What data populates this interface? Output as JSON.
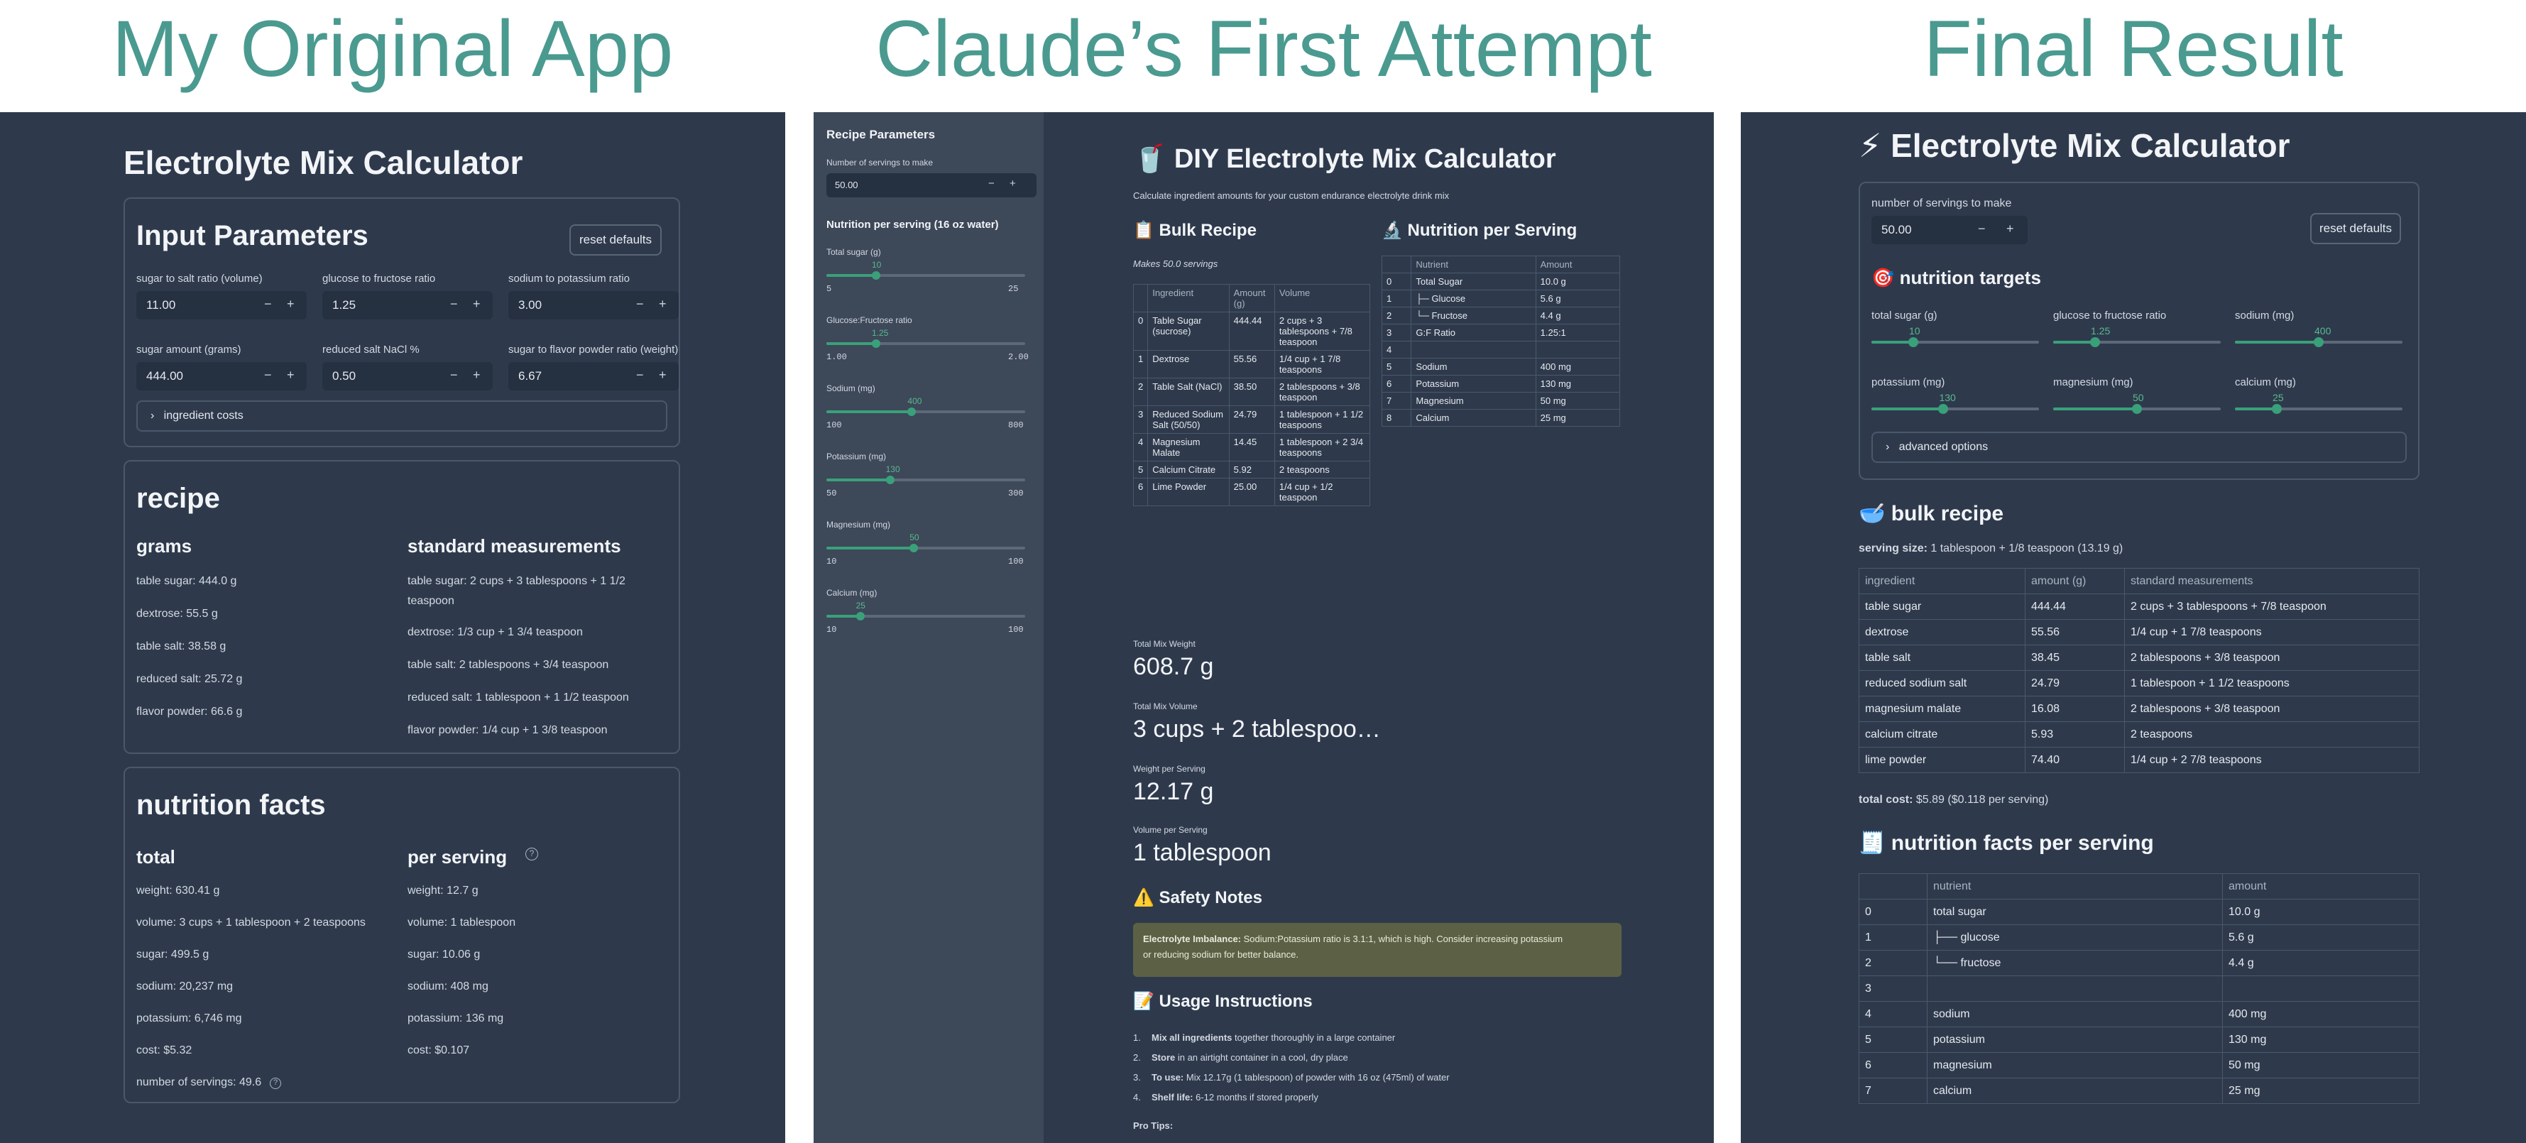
{
  "headings": {
    "original": "My Original App",
    "first": "Claude’s First Attempt",
    "final": "Final Result"
  },
  "original": {
    "title": "Electrolyte Mix Calculator",
    "input_title": "Input Parameters",
    "reset": "reset defaults",
    "fields": [
      {
        "label": "sugar to salt ratio (volume)",
        "value": "11.00"
      },
      {
        "label": "glucose to fructose ratio",
        "value": "1.25"
      },
      {
        "label": "sodium to potassium ratio",
        "value": "3.00"
      },
      {
        "label": "sugar amount (grams)",
        "value": "444.00"
      },
      {
        "label": "reduced salt NaCl %",
        "value": "0.50"
      },
      {
        "label": "sugar to flavor powder ratio (weight)",
        "value": "6.67"
      }
    ],
    "costs_expander": "ingredient costs",
    "recipe_title": "recipe",
    "grams_title": "grams",
    "grams": [
      "table sugar: 444.0 g",
      "dextrose: 55.5 g",
      "table salt: 38.58 g",
      "reduced salt: 25.72 g",
      "flavor powder: 66.6 g"
    ],
    "std_title": "standard measurements",
    "std_lines": [
      "table sugar: 2 cups + 3 tablespoons + 1 1/2",
      "teaspoon",
      "dextrose: 1/3 cup + 1 3/4 teaspoon",
      "table salt: 2 tablespoons + 3/4 teaspoon",
      "reduced salt: 1 tablespoon + 1 1/2 teaspoon",
      "flavor powder: 1/4 cup + 1 3/8 teaspoon"
    ],
    "nf_title": "nutrition facts",
    "total_title": "total",
    "total": [
      "weight: 630.41 g",
      "volume: 3 cups + 1 tablespoon + 2 teaspoons",
      "sugar: 499.5 g",
      "sodium: 20,237 mg",
      "potassium: 6,746 mg",
      "cost: $5.32"
    ],
    "per_title": "per serving",
    "per": [
      "weight: 12.7 g",
      "volume: 1 tablespoon",
      "sugar: 10.06 g",
      "sodium: 408 mg",
      "potassium: 136 mg",
      "cost: $0.107"
    ],
    "servings": "number of servings: 49.6"
  },
  "first": {
    "sidebar": {
      "title": "Recipe Parameters",
      "servings_label": "Number of servings to make",
      "servings_value": "50.00",
      "nutrition_title": "Nutrition per serving (16 oz water)",
      "sliders": [
        {
          "label": "Total sugar (g)",
          "value": "10",
          "min": "5",
          "max": "25",
          "frac": 0.25
        },
        {
          "label": "Glucose:Fructose ratio",
          "value": "1.25",
          "min": "1.00",
          "max": "2.00",
          "frac": 0.25
        },
        {
          "label": "Sodium (mg)",
          "value": "400",
          "min": "100",
          "max": "800",
          "frac": 0.43
        },
        {
          "label": "Potassium (mg)",
          "value": "130",
          "min": "50",
          "max": "300",
          "frac": 0.32
        },
        {
          "label": "Magnesium (mg)",
          "value": "50",
          "min": "10",
          "max": "100",
          "frac": 0.44
        },
        {
          "label": "Calcium (mg)",
          "value": "25",
          "min": "10",
          "max": "100",
          "frac": 0.17
        }
      ]
    },
    "title": "🥤 DIY Electrolyte Mix Calculator",
    "subtitle": "Calculate ingredient amounts for your custom endurance electrolyte drink mix",
    "bulk_title": "📋 Bulk Recipe",
    "makes": "Makes 50.0 servings",
    "bulk_headers": [
      "",
      "Ingredient",
      "Amount (g)",
      "Volume"
    ],
    "bulk_rows": [
      [
        "0",
        "Table Sugar (sucrose)",
        "444.44",
        "2 cups + 3 tablespoons + 7/8 teaspoon"
      ],
      [
        "1",
        "Dextrose",
        "55.56",
        "1/4 cup + 1 7/8 teaspoons"
      ],
      [
        "2",
        "Table Salt (NaCl)",
        "38.50",
        "2 tablespoons + 3/8 teaspoon"
      ],
      [
        "3",
        "Reduced Sodium Salt (50/50)",
        "24.79",
        "1 tablespoon + 1 1/2 teaspoons"
      ],
      [
        "4",
        "Magnesium Malate",
        "14.45",
        "1 tablespoon + 2 3/4 teaspoons"
      ],
      [
        "5",
        "Calcium Citrate",
        "5.92",
        "2 teaspoons"
      ],
      [
        "6",
        "Lime Powder",
        "25.00",
        "1/4 cup + 1/2 teaspoon"
      ]
    ],
    "nps_title": "🔬 Nutrition per Serving",
    "nps_headers": [
      "",
      "Nutrient",
      "Amount"
    ],
    "nps_rows": [
      [
        "0",
        "Total Sugar",
        "10.0 g"
      ],
      [
        "1",
        "├─ Glucose",
        "5.6 g"
      ],
      [
        "2",
        "└─ Fructose",
        "4.4 g"
      ],
      [
        "3",
        "G:F Ratio",
        "1.25:1"
      ],
      [
        "4",
        "",
        ""
      ],
      [
        "5",
        "Sodium",
        "400 mg"
      ],
      [
        "6",
        "Potassium",
        "130 mg"
      ],
      [
        "7",
        "Magnesium",
        "50 mg"
      ],
      [
        "8",
        "Calcium",
        "25 mg"
      ]
    ],
    "metrics": [
      {
        "label": "Total Mix Weight",
        "value": "608.7 g"
      },
      {
        "label": "Total Mix Volume",
        "value": "3 cups + 2 tablespoo…"
      },
      {
        "label": "Weight per Serving",
        "value": "12.17 g"
      },
      {
        "label": "Volume per Serving",
        "value": "1 tablespoon"
      }
    ],
    "safety_title": "⚠️ Safety Notes",
    "warn_bold": "Electrolyte Imbalance:",
    "warn_text1": " Sodium:Potassium ratio is 3.1:1, which is high. Consider increasing potassium",
    "warn_text2": "or reducing sodium for better balance.",
    "usage_title": "📝 Usage Instructions",
    "usage": [
      {
        "n": "1.",
        "b": "Mix all ingredients",
        "t": " together thoroughly in a large container"
      },
      {
        "n": "2.",
        "b": "Store",
        "t": " in an airtight container in a cool, dry place"
      },
      {
        "n": "3.",
        "b": "To use:",
        "t": " Mix 12.17g (1 tablespoon) of powder with 16 oz (475ml) of water"
      },
      {
        "n": "4.",
        "b": "Shelf life:",
        "t": " 6-12 months if stored properly"
      }
    ],
    "protips": "Pro Tips:"
  },
  "final": {
    "title": "⚡ Electrolyte Mix Calculator",
    "servings_label": "number of servings to make",
    "servings_value": "50.00",
    "reset": "reset defaults",
    "targets_title": "🎯 nutrition targets",
    "sliders": [
      {
        "label": "total sugar (g)",
        "value": "10",
        "frac": 0.25
      },
      {
        "label": "glucose to fructose ratio",
        "value": "1.25",
        "frac": 0.25
      },
      {
        "label": "sodium (mg)",
        "value": "400",
        "frac": 0.5
      },
      {
        "label": "potassium (mg)",
        "value": "130",
        "frac": 0.43
      },
      {
        "label": "magnesium (mg)",
        "value": "50",
        "frac": 0.5
      },
      {
        "label": "calcium (mg)",
        "value": "25",
        "frac": 0.25
      }
    ],
    "advanced": "advanced options",
    "bulk_title": "🥣 bulk recipe",
    "serving_bold": "serving size:",
    "serving_text": " 1 tablespoon + 1/8 teaspoon (13.19 g)",
    "bulk_headers": [
      "ingredient",
      "amount (g)",
      "standard measurements"
    ],
    "bulk_rows": [
      [
        "table sugar",
        "444.44",
        "2 cups + 3 tablespoons + 7/8 teaspoon"
      ],
      [
        "dextrose",
        "55.56",
        "1/4 cup + 1 7/8 teaspoons"
      ],
      [
        "table salt",
        "38.45",
        "2 tablespoons + 3/8 teaspoon"
      ],
      [
        "reduced sodium salt",
        "24.79",
        "1 tablespoon + 1 1/2 teaspoons"
      ],
      [
        "magnesium malate",
        "16.08",
        "2 tablespoons + 3/8 teaspoon"
      ],
      [
        "calcium citrate",
        "5.93",
        "2 teaspoons"
      ],
      [
        "lime powder",
        "74.40",
        "1/4 cup + 2 7/8 teaspoons"
      ]
    ],
    "cost_bold": "total cost:",
    "cost_text": " $5.89 ($0.118 per serving)",
    "nf_title": "🧾 nutrition facts per serving",
    "nf_headers": [
      "",
      "nutrient",
      "amount"
    ],
    "nf_rows": [
      [
        "0",
        "total sugar",
        "10.0 g"
      ],
      [
        "1",
        "├── glucose",
        "5.6 g"
      ],
      [
        "2",
        "└── fructose",
        "4.4 g"
      ],
      [
        "3",
        "",
        ""
      ],
      [
        "4",
        "sodium",
        "400 mg"
      ],
      [
        "5",
        "potassium",
        "130 mg"
      ],
      [
        "6",
        "magnesium",
        "50 mg"
      ],
      [
        "7",
        "calcium",
        "25 mg"
      ]
    ]
  }
}
